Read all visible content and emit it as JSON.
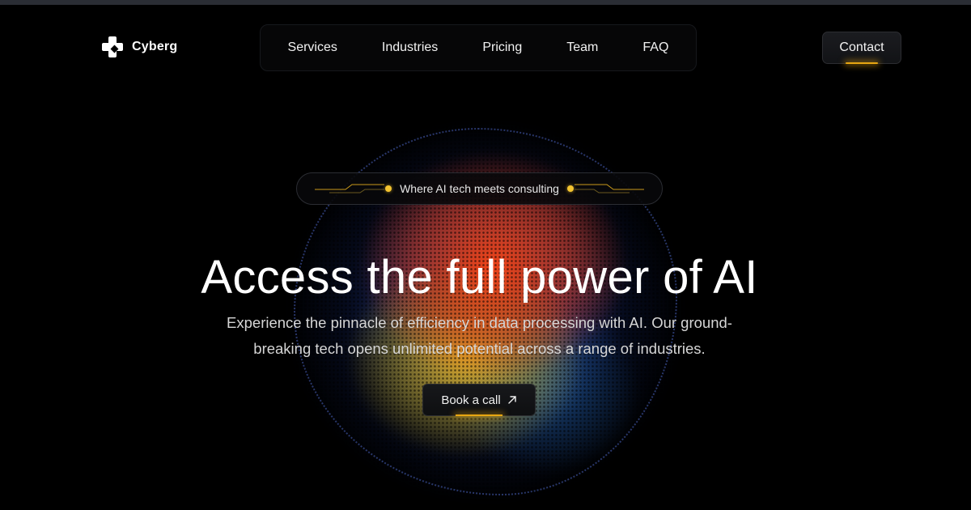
{
  "brand": {
    "name": "Cyberg"
  },
  "nav": {
    "items": [
      {
        "label": "Services"
      },
      {
        "label": "Industries"
      },
      {
        "label": "Pricing"
      },
      {
        "label": "Team"
      },
      {
        "label": "FAQ"
      }
    ],
    "contact_label": "Contact"
  },
  "hero": {
    "tagline": "Where AI tech meets consulting",
    "headline": "Access the full power of AI",
    "description": "Experience the pinnacle of efficiency in data processing with AI. Our ground-breaking tech opens unlimited potential across a range of industries.",
    "cta_label": "Book a call",
    "cta_icon": "arrow-up-right-icon"
  },
  "colors": {
    "background": "#000000",
    "accent": "#e8a612",
    "tagline_dot": "#f4c430"
  }
}
